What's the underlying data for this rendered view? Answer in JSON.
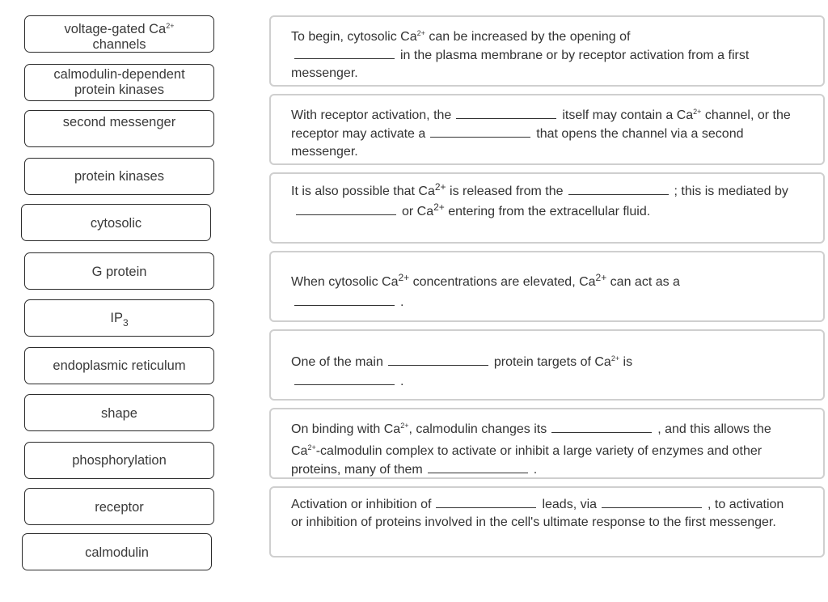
{
  "terms": {
    "t0": {
      "pre": "voltage-gated Ca",
      "sup": "2+",
      "post": "",
      "line2": "channels"
    },
    "t1": {
      "line1": "calmodulin-dependent",
      "line2": "protein kinases"
    },
    "t2": {
      "label": "second messenger"
    },
    "t3": {
      "label": "protein kinases"
    },
    "t4": {
      "label": "cytosolic"
    },
    "t5": {
      "label": "G protein"
    },
    "t6": {
      "pre": "IP",
      "sub": "3"
    },
    "t7": {
      "label": "endoplasmic reticulum"
    },
    "t8": {
      "label": "shape"
    },
    "t9": {
      "label": "phosphorylation"
    },
    "t10": {
      "label": "receptor"
    },
    "t11": {
      "label": "calmodulin"
    }
  },
  "sentences": {
    "s0": {
      "a": "To begin, cytosolic Ca",
      "sup1": "2+",
      "b": " can be increased by the opening of",
      "c": "in the plasma membrane or by receptor activation from a first messenger."
    },
    "s1": {
      "a": "With receptor activation, the",
      "b": "itself may contain a Ca",
      "sup1": "2+",
      "c": "channel, or the receptor may activate a",
      "d": "that opens the channel via a second messenger."
    },
    "s2": {
      "a": "It is also possible that Ca",
      "sup1": "2+",
      "b": " is released from the",
      "c": "; this is mediated by",
      "d": "or Ca",
      "sup2": "2+",
      "e": " entering from the extracellular fluid."
    },
    "s3": {
      "a": "When cytosolic Ca",
      "sup1": "2+",
      "b": " concentrations are elevated, Ca",
      "sup2": "2+",
      "c": " can act as a",
      "d": "."
    },
    "s4": {
      "a": "One of the main",
      "b": "protein targets of Ca",
      "sup1": "2+",
      "c": " is",
      "d": "."
    },
    "s5": {
      "a": "On binding with Ca",
      "sup1": "2+",
      "b": ", calmodulin changes its",
      "c": ", and this allows the Ca",
      "sup2": "2+",
      "d": "-calmodulin complex to activate or inhibit a large variety of enzymes and other proteins, many of them",
      "e": "."
    },
    "s6": {
      "a": "Activation or inhibition of",
      "b": "leads, via",
      "c": ", to activation or inhibition of proteins involved in the cell's ultimate response to the first messenger."
    }
  }
}
